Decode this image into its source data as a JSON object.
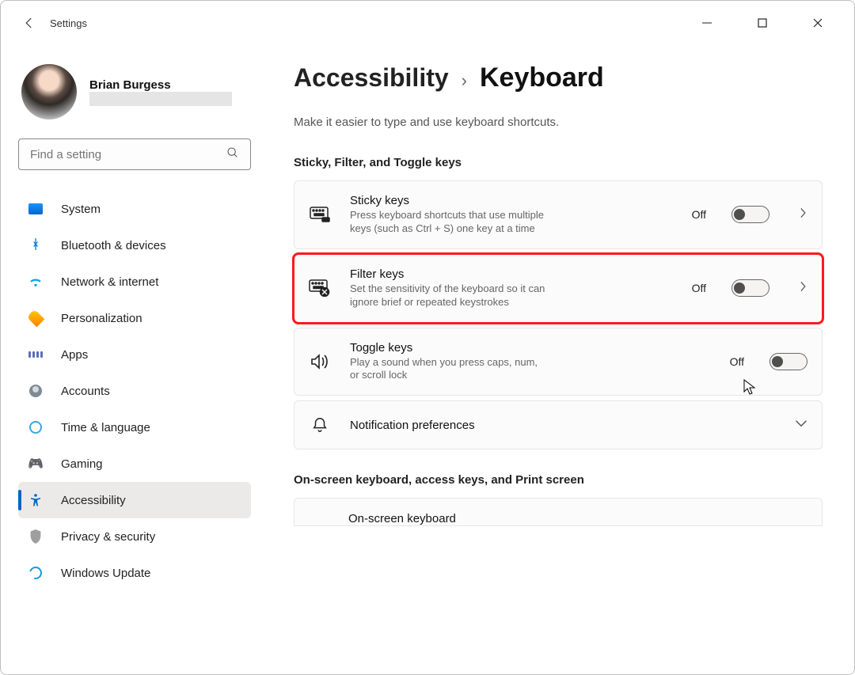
{
  "app_title": "Settings",
  "profile": {
    "name": "Brian Burgess"
  },
  "search": {
    "placeholder": "Find a setting"
  },
  "nav": {
    "system": "System",
    "bluetooth": "Bluetooth & devices",
    "network": "Network & internet",
    "personalization": "Personalization",
    "apps": "Apps",
    "accounts": "Accounts",
    "time": "Time & language",
    "gaming": "Gaming",
    "accessibility": "Accessibility",
    "privacy": "Privacy & security",
    "update": "Windows Update"
  },
  "breadcrumb": {
    "parent": "Accessibility",
    "sep": "›",
    "current": "Keyboard"
  },
  "page_desc": "Make it easier to type and use keyboard shortcuts.",
  "section1_title": "Sticky, Filter, and Toggle keys",
  "sticky": {
    "title": "Sticky keys",
    "desc": "Press keyboard shortcuts that use multiple keys (such as Ctrl + S) one key at a time",
    "state": "Off"
  },
  "filter": {
    "title": "Filter keys",
    "desc": "Set the sensitivity of the keyboard so it can ignore brief or repeated keystrokes",
    "state": "Off"
  },
  "toggle": {
    "title": "Toggle keys",
    "desc": "Play a sound when you press caps, num, or scroll lock",
    "state": "Off"
  },
  "notif": {
    "title": "Notification preferences"
  },
  "section2_title": "On-screen keyboard, access keys, and Print screen",
  "osk": {
    "title": "On-screen keyboard"
  }
}
